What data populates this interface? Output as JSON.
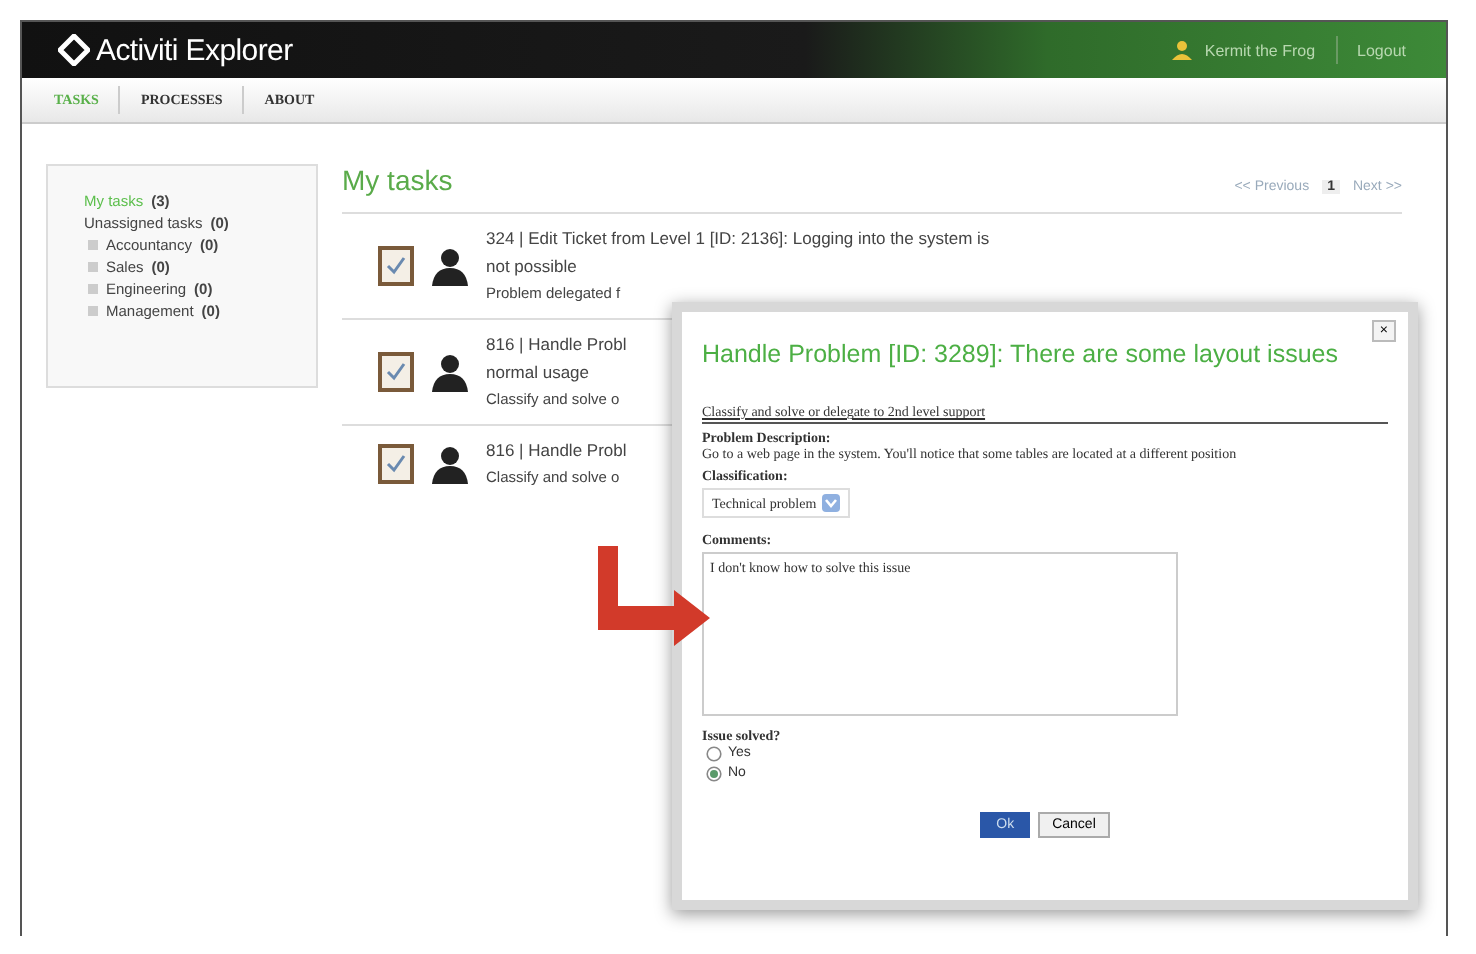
{
  "app": {
    "title": "Activiti Explorer",
    "user": "Kermit the Frog",
    "logout": "Logout"
  },
  "nav": [
    {
      "label": "TASKS",
      "selected": true
    },
    {
      "label": "PROCESSES",
      "selected": false
    },
    {
      "label": "ABOUT",
      "selected": false
    }
  ],
  "sidebar": {
    "items": [
      {
        "label": "My tasks",
        "count": "(3)",
        "selected": true
      },
      {
        "label": "Unassigned tasks",
        "count": "(0)",
        "selected": false,
        "children": [
          {
            "label": "Accountancy",
            "count": "(0)",
            "selected": false
          },
          {
            "label": "Sales",
            "count": "(0)",
            "selected": false
          },
          {
            "label": "Engineering",
            "count": "(0)",
            "selected": false
          },
          {
            "label": "Management",
            "count": "(0)",
            "selected": false
          }
        ]
      }
    ]
  },
  "main": {
    "title": "My tasks",
    "pager": {
      "previous": "<< Previous",
      "page": "1",
      "next": "Next >>"
    },
    "tasks": [
      {
        "lines": [
          "324 | Edit Ticket from Level 1 [ID: 2136]: Logging into the system is",
          "not possible",
          "Problem delegated f"
        ]
      },
      {
        "lines": [
          "816 | Handle Probl",
          "normal usage",
          "Classify and solve o"
        ]
      },
      {
        "lines": [
          "816 | Handle Probl",
          "Classify and solve o"
        ]
      }
    ]
  },
  "dialog": {
    "close": "×",
    "title": "Handle Problem [ID: 3289]: There are some layout issues",
    "subtitle": "Classify and solve or delegate to 2nd level support",
    "description_label": "Problem Description:",
    "description": "Go to a web page in the system. You'll notice that some tables are located at a different position",
    "classification_label": "Classification:",
    "classification": "Technical problem",
    "comments_label": "Comments:",
    "comments": "I don't know how to solve this issue",
    "solved_label": "Issue solved?",
    "options": [
      {
        "label": "Yes",
        "selected": false
      },
      {
        "label": "No",
        "selected": true
      }
    ],
    "ok": "Ok",
    "cancel": "Cancel"
  }
}
